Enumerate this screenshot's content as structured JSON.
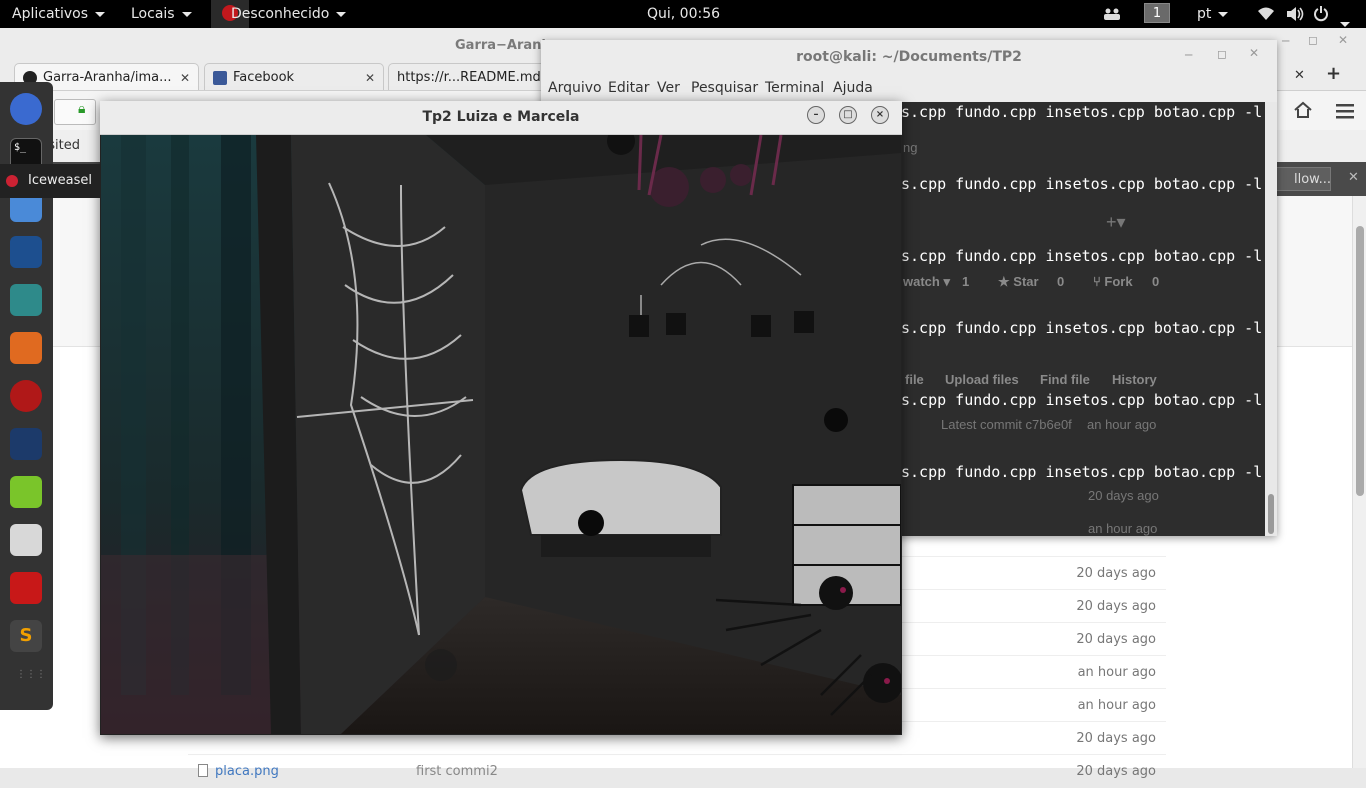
{
  "topbar": {
    "applications": "Aplicativos",
    "places": "Locais",
    "active_app": "Desconhecido",
    "clock": "Qui, 00:56",
    "workspace": "1",
    "keyboard_layout": "pt"
  },
  "browser": {
    "window_title": "Garra−Aranha",
    "tabs": [
      {
        "label": "Garra-Aranha/ima...",
        "close": "✕"
      },
      {
        "label": "Facebook",
        "close": "✕"
      },
      {
        "label": "https://r...README.md"
      }
    ],
    "new_tab": "+",
    "bookmarks_label": "st Visited",
    "notif_close": "✕",
    "follow_button": "llow...",
    "repo_actions": {
      "watch": "watch",
      "watch_count": "1",
      "star": "Star",
      "star_count": "0",
      "fork": "Fork",
      "fork_count": "0"
    },
    "file_actions": [
      "file",
      "Upload files",
      "Find file",
      "History"
    ],
    "latest_commit": "Latest commit c7b6e0f",
    "latest_commit_time": "an hour ago",
    "rows": [
      {
        "age": "20 days ago"
      },
      {
        "age": "an hour ago"
      },
      {
        "age": "20 days ago"
      },
      {
        "age": "20 days ago"
      },
      {
        "age": "20 days ago"
      },
      {
        "age": "an hour ago"
      },
      {
        "age": "an hour ago"
      },
      {
        "age": "20 days ago"
      },
      {
        "name": "placa.png",
        "message": "first commi2",
        "age": "20 days ago"
      }
    ],
    "partial_text": "ng"
  },
  "terminal": {
    "title": "root@kali: ~/Documents/TP2",
    "menu": [
      "Arquivo",
      "Editar",
      "Ver",
      "Pesquisar",
      "Terminal",
      "Ajuda"
    ],
    "lines": [
      "s.cpp fundo.cpp insetos.cpp botao.cpp -l",
      "s.cpp fundo.cpp insetos.cpp botao.cpp -l",
      "s.cpp fundo.cpp insetos.cpp botao.cpp -l",
      "s.cpp fundo.cpp insetos.cpp botao.cpp -l",
      "s.cpp fundo.cpp insetos.cpp botao.cpp -l",
      "s.cpp fundo.cpp insetos.cpp botao.cpp -l"
    ]
  },
  "dock": {
    "tooltip": "Iceweasel",
    "apps": [
      "iceweasel-icon",
      "terminal-icon",
      "files-icon",
      "metasploit-icon",
      "armitage-icon",
      "burpsuite-icon",
      "faraday-icon",
      "maltego-icon",
      "leafpad-icon",
      "gui-tool-icon",
      "recordmydesktop-icon",
      "sublime-icon",
      "app-grid-icon"
    ]
  },
  "glwindow": {
    "title": "Tp2 Luiza e Marcela"
  },
  "colors": {
    "topbar": "#000000",
    "terminal_bg": "#2d2d2d",
    "spider": "#8a1a4a",
    "link": "#4078c0"
  }
}
